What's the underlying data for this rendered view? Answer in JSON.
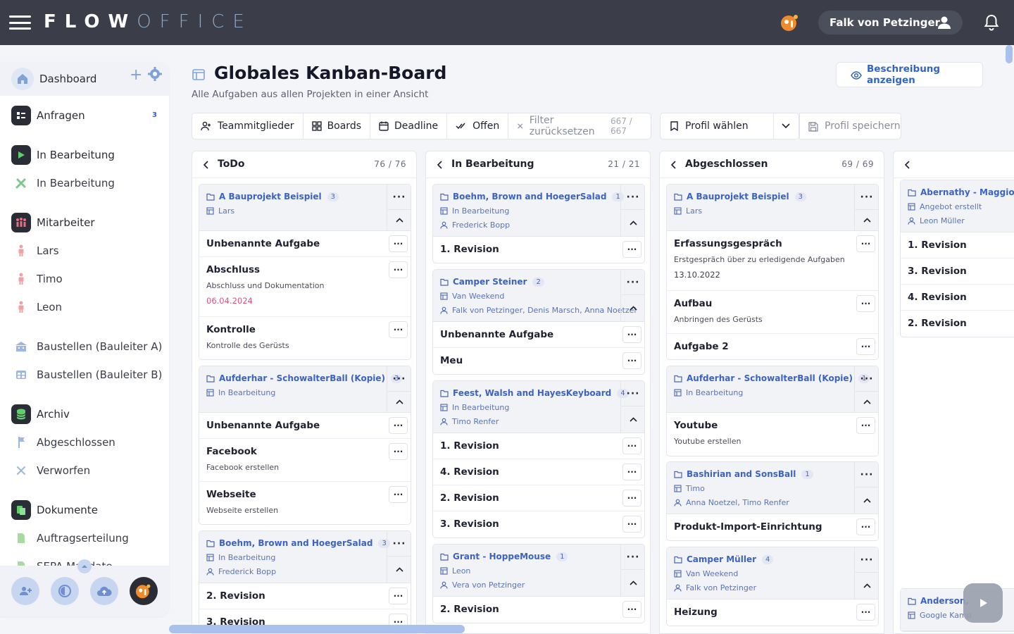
{
  "topbar": {
    "logo_bold": "FLOW",
    "logo_light": "OFFICE",
    "user_name": "Falk von Petzinger"
  },
  "sidebar": {
    "dashboard": "Dashboard",
    "items": [
      {
        "label": "Anfragen",
        "badge": "3"
      },
      {
        "label": "In Bearbeitung"
      },
      {
        "label": "In Bearbeitung"
      },
      {
        "label": "Mitarbeiter"
      },
      {
        "label": "Lars"
      },
      {
        "label": "Timo"
      },
      {
        "label": "Leon"
      },
      {
        "label": "Baustellen (Bauleiter A)"
      },
      {
        "label": "Baustellen (Bauleiter B)"
      },
      {
        "label": "Archiv"
      },
      {
        "label": "Abgeschlossen"
      },
      {
        "label": "Verworfen"
      },
      {
        "label": "Dokumente"
      },
      {
        "label": "Auftragserteilung"
      },
      {
        "label": "SEPA Mandate"
      }
    ]
  },
  "header": {
    "title": "Globales Kanban-Board",
    "subtitle": "Alle Aufgaben aus allen Projekten in einer Ansicht",
    "desc_button": "Beschreibung anzeigen"
  },
  "filters": {
    "team": "Teammitglieder",
    "boards": "Boards",
    "deadline": "Deadline",
    "open": "Offen",
    "reset": "Filter zurücksetzen",
    "count": "667 / 667",
    "profile_select": "Profil wählen",
    "profile_save": "Profil speichern"
  },
  "columns": [
    {
      "title": "ToDo",
      "count": "76 / 76",
      "groups": [
        {
          "project": "A Bauprojekt Beispiel",
          "badge": "3",
          "board": "Lars",
          "users": "",
          "tasks": [
            {
              "title": "Unbenannte Aufgabe",
              "desc": "",
              "date": ""
            },
            {
              "title": "Abschluss",
              "desc": "Abschluss und Dokumentation",
              "date": "06.04.2024"
            },
            {
              "title": "Kontrolle",
              "desc": "Kontrolle des Gerüsts",
              "date": ""
            }
          ]
        },
        {
          "project": "Aufderhar - SchowalterBall (Kopie)",
          "badge": "3",
          "board": "In Bearbeitung",
          "users": "",
          "tasks": [
            {
              "title": "Unbenannte Aufgabe",
              "desc": "",
              "date": ""
            },
            {
              "title": "Facebook",
              "desc": "Facebook erstellen",
              "date": ""
            },
            {
              "title": "Webseite",
              "desc": "Webseite erstellen",
              "date": ""
            }
          ]
        },
        {
          "project": "Boehm, Brown and HoegerSalad",
          "badge": "3",
          "board": "In Bearbeitung",
          "users": "Frederick Bopp",
          "tasks": [
            {
              "title": "2. Revision",
              "desc": "",
              "date": ""
            },
            {
              "title": "3. Revision",
              "desc": "",
              "date": ""
            }
          ]
        }
      ]
    },
    {
      "title": "In Bearbeitung",
      "count": "21 / 21",
      "groups": [
        {
          "project": "Boehm, Brown and HoegerSalad",
          "badge": "1",
          "board": "In Bearbeitung",
          "users": "Frederick Bopp",
          "tasks": [
            {
              "title": "1. Revision",
              "desc": "",
              "date": ""
            }
          ]
        },
        {
          "project": "Camper Steiner",
          "badge": "2",
          "board": "Van Weekend",
          "users": "Falk von Petzinger, Denis Marsch, Anna Noetzel",
          "tasks": [
            {
              "title": "Unbenannte Aufgabe",
              "desc": "",
              "date": ""
            },
            {
              "title": "Meu",
              "desc": "",
              "date": ""
            }
          ]
        },
        {
          "project": "Feest, Walsh and HayesKeyboard",
          "badge": "4",
          "board": "In Bearbeitung",
          "users": "Timo Renfer",
          "tasks": [
            {
              "title": "1. Revision",
              "desc": "",
              "date": ""
            },
            {
              "title": "4. Revision",
              "desc": "",
              "date": ""
            },
            {
              "title": "2. Revision",
              "desc": "",
              "date": ""
            },
            {
              "title": "3. Revision",
              "desc": "",
              "date": ""
            }
          ]
        },
        {
          "project": "Grant - HoppeMouse",
          "badge": "1",
          "board": "Leon",
          "users": "Vera von Petzinger",
          "tasks": [
            {
              "title": "2. Revision",
              "desc": "",
              "date": ""
            }
          ]
        }
      ]
    },
    {
      "title": "Abgeschlossen",
      "count": "69 / 69",
      "groups": [
        {
          "project": "A Bauprojekt Beispiel",
          "badge": "3",
          "board": "Lars",
          "users": "",
          "tasks": [
            {
              "title": "Erfassungsgespräch",
              "desc": "Erstgespräch über zu erledigende Aufgaben",
              "date": "13.10.2022"
            },
            {
              "title": "Aufbau",
              "desc": "Anbringen des Gerüsts",
              "date": ""
            },
            {
              "title": "Aufgabe 2",
              "desc": "",
              "date": ""
            }
          ]
        },
        {
          "project": "Aufderhar - SchowalterBall (Kopie)",
          "badge": "1",
          "board": "In Bearbeitung",
          "users": "",
          "tasks": [
            {
              "title": "Youtube",
              "desc": "Youtube erstellen",
              "date": ""
            }
          ]
        },
        {
          "project": "Bashirian and SonsBall",
          "badge": "1",
          "board": "Timo",
          "users": "Anna Noetzel, Timo Renfer",
          "tasks": [
            {
              "title": "Produkt-Import-Einrichtung",
              "desc": "",
              "date": ""
            }
          ]
        },
        {
          "project": "Camper Müller",
          "badge": "4",
          "board": "Van Weekend",
          "users": "Falk von Petzinger",
          "tasks": [
            {
              "title": "Heizung",
              "desc": "",
              "date": ""
            }
          ]
        }
      ]
    },
    {
      "title": "",
      "count": "",
      "groups": [
        {
          "project": "Abernathy - MaggioHa",
          "badge": "",
          "board": "Angebot erstellt",
          "users": "Leon Müller",
          "tasks": [
            {
              "title": "1. Revision",
              "desc": "",
              "date": ""
            },
            {
              "title": "3. Revision",
              "desc": "",
              "date": ""
            },
            {
              "title": "4. Revision",
              "desc": "",
              "date": ""
            },
            {
              "title": "2. Revision",
              "desc": "",
              "date": ""
            }
          ]
        },
        {
          "project": "Anderson,",
          "badge": "",
          "board": "Google Kamp",
          "users": "",
          "tasks": []
        }
      ]
    }
  ]
}
